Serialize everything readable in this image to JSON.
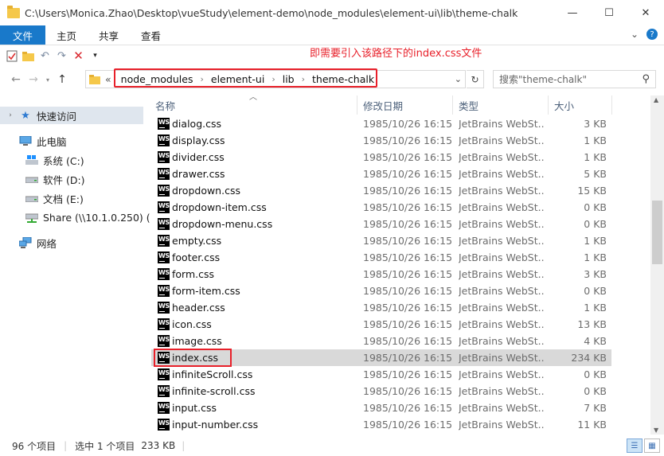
{
  "window": {
    "title": "C:\\Users\\Monica.Zhao\\Desktop\\vueStudy\\element-demo\\node_modules\\element-ui\\lib\\theme-chalk",
    "minimize": "—",
    "maximize": "☐",
    "close": "✕"
  },
  "ribbon": {
    "tabs": [
      "文件",
      "主页",
      "共享",
      "查看"
    ]
  },
  "annotation": "即需要引入该路径下的index.css文件",
  "address": {
    "overflow": "«",
    "crumbs": [
      "node_modules",
      "element-ui",
      "lib",
      "theme-chalk"
    ],
    "search_placeholder": "搜索\"theme-chalk\""
  },
  "sidebar": {
    "quick_access": "快速访问",
    "this_pc": "此电脑",
    "drives": [
      "系统 (C:)",
      "软件 (D:)",
      "文档 (E:)",
      "Share (\\\\10.1.0.250) ("
    ],
    "network": "网络"
  },
  "columns": {
    "name": "名称",
    "date": "修改日期",
    "type": "类型",
    "size": "大小"
  },
  "files": [
    {
      "name": "dialog.css",
      "date": "1985/10/26 16:15",
      "type": "JetBrains WebSt...",
      "size": "3 KB"
    },
    {
      "name": "display.css",
      "date": "1985/10/26 16:15",
      "type": "JetBrains WebSt...",
      "size": "1 KB"
    },
    {
      "name": "divider.css",
      "date": "1985/10/26 16:15",
      "type": "JetBrains WebSt...",
      "size": "1 KB"
    },
    {
      "name": "drawer.css",
      "date": "1985/10/26 16:15",
      "type": "JetBrains WebSt...",
      "size": "5 KB"
    },
    {
      "name": "dropdown.css",
      "date": "1985/10/26 16:15",
      "type": "JetBrains WebSt...",
      "size": "15 KB"
    },
    {
      "name": "dropdown-item.css",
      "date": "1985/10/26 16:15",
      "type": "JetBrains WebSt...",
      "size": "0 KB"
    },
    {
      "name": "dropdown-menu.css",
      "date": "1985/10/26 16:15",
      "type": "JetBrains WebSt...",
      "size": "0 KB"
    },
    {
      "name": "empty.css",
      "date": "1985/10/26 16:15",
      "type": "JetBrains WebSt...",
      "size": "1 KB"
    },
    {
      "name": "footer.css",
      "date": "1985/10/26 16:15",
      "type": "JetBrains WebSt...",
      "size": "1 KB"
    },
    {
      "name": "form.css",
      "date": "1985/10/26 16:15",
      "type": "JetBrains WebSt...",
      "size": "3 KB"
    },
    {
      "name": "form-item.css",
      "date": "1985/10/26 16:15",
      "type": "JetBrains WebSt...",
      "size": "0 KB"
    },
    {
      "name": "header.css",
      "date": "1985/10/26 16:15",
      "type": "JetBrains WebSt...",
      "size": "1 KB"
    },
    {
      "name": "icon.css",
      "date": "1985/10/26 16:15",
      "type": "JetBrains WebSt...",
      "size": "13 KB"
    },
    {
      "name": "image.css",
      "date": "1985/10/26 16:15",
      "type": "JetBrains WebSt...",
      "size": "4 KB"
    },
    {
      "name": "index.css",
      "date": "1985/10/26 16:15",
      "type": "JetBrains WebSt...",
      "size": "234 KB"
    },
    {
      "name": "infiniteScroll.css",
      "date": "1985/10/26 16:15",
      "type": "JetBrains WebSt...",
      "size": "0 KB"
    },
    {
      "name": "infinite-scroll.css",
      "date": "1985/10/26 16:15",
      "type": "JetBrains WebSt...",
      "size": "0 KB"
    },
    {
      "name": "input.css",
      "date": "1985/10/26 16:15",
      "type": "JetBrains WebSt...",
      "size": "7 KB"
    },
    {
      "name": "input-number.css",
      "date": "1985/10/26 16:15",
      "type": "JetBrains WebSt...",
      "size": "11 KB"
    }
  ],
  "selected_file": "index.css",
  "status": {
    "count": "96 个项目",
    "selected": "选中 1 个项目",
    "selected_size": "233 KB"
  },
  "colors": {
    "accent": "#1979ca",
    "annotation": "#e8202a",
    "selected_row": "#d9d9d9"
  }
}
